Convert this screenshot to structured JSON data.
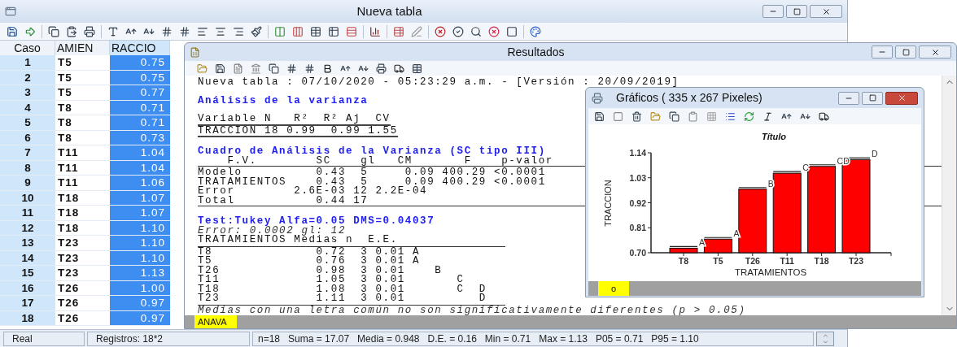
{
  "main_window": {
    "title": "Nueva tabla"
  },
  "grid": {
    "columns": [
      {
        "label": "Caso",
        "kind": "index",
        "selected": false
      },
      {
        "label": "AMIEN",
        "kind": "text",
        "selected": false
      },
      {
        "label": "RACCIO",
        "kind": "number",
        "selected": true
      }
    ],
    "rows": [
      [
        "1",
        "T5",
        "0.75"
      ],
      [
        "2",
        "T5",
        "0.75"
      ],
      [
        "3",
        "T5",
        "0.77"
      ],
      [
        "4",
        "T8",
        "0.71"
      ],
      [
        "5",
        "T8",
        "0.71"
      ],
      [
        "6",
        "T8",
        "0.73"
      ],
      [
        "7",
        "T11",
        "1.04"
      ],
      [
        "8",
        "T11",
        "1.04"
      ],
      [
        "9",
        "T11",
        "1.06"
      ],
      [
        "10",
        "T18",
        "1.07"
      ],
      [
        "11",
        "T18",
        "1.07"
      ],
      [
        "12",
        "T18",
        "1.10"
      ],
      [
        "13",
        "T23",
        "1.10"
      ],
      [
        "14",
        "T23",
        "1.10"
      ],
      [
        "15",
        "T23",
        "1.13"
      ],
      [
        "16",
        "T26",
        "1.00"
      ],
      [
        "17",
        "T26",
        "0.97"
      ],
      [
        "18",
        "T26",
        "0.97"
      ]
    ]
  },
  "status_bar": {
    "type": "Real",
    "records": "Registros: 18*2",
    "stats": "n=18   Suma = 17.07   Media = 0.948   D.E. = 0.16   Min = 0.71   Max = 1.13   P05 = 0.71   P95 = 1.10"
  },
  "results_window": {
    "title": "Resultados",
    "lines": [
      {
        "text": "Nueva tabla : 07/10/2020 - 05:23:29 a.m. - [Versión : 20/09/2019]",
        "kind": "plain"
      },
      {
        "text": "Análisis de la varianza",
        "kind": "heading",
        "space_before": true
      },
      {
        "text": "Variable N   R²  R² Aj  CV",
        "kind": "plain",
        "space_before": true,
        "rule_below": true
      },
      {
        "text": "TRACCION 18 0.99  0.99 1.55",
        "kind": "plain",
        "rule_below": true
      },
      {
        "text": "Cuadro de Análisis de la Varianza (SC tipo III)",
        "kind": "heading",
        "space_before": true
      },
      {
        "text": "    F.V.        SC    gl   CM       F    p-valor",
        "kind": "plain",
        "rule_below": true,
        "rule_full_width": true
      },
      {
        "text": "Modelo          0.43  5     0.09 400.29 <0.0001",
        "kind": "plain"
      },
      {
        "text": "TRATAMIENTOS    0.43  5     0.09 400.29 <0.0001",
        "kind": "plain"
      },
      {
        "text": "Error        2.6E-03 12 2.2E-04",
        "kind": "plain"
      },
      {
        "text": "Total           0.44 17",
        "kind": "plain",
        "rule_below": true,
        "rule_full_width": true
      },
      {
        "text": "Test:Tukey Alfa=0.05 DMS=0.04037",
        "kind": "heading",
        "space_before": true
      },
      {
        "text": "Error: 0.0002 gl: 12",
        "kind": "italic"
      },
      {
        "text": "TRATAMIENTOS Medias n  E.E.",
        "kind": "plain",
        "rule_below": true,
        "rule_table_width": true
      },
      {
        "text": "T8              0.72  3 0.01 A",
        "kind": "plain"
      },
      {
        "text": "T5              0.76  3 0.01 A",
        "kind": "plain"
      },
      {
        "text": "T26             0.98  3 0.01    B",
        "kind": "plain"
      },
      {
        "text": "T11             1.05  3 0.01       C",
        "kind": "plain"
      },
      {
        "text": "T18             1.08  3 0.01       C  D",
        "kind": "plain"
      },
      {
        "text": "T23             1.11  3 0.01          D",
        "kind": "plain",
        "rule_below": true,
        "rule_table_width": true
      },
      {
        "text": "Medias con una letra común no son significativamente diferentes (p > 0.05)",
        "kind": "italic"
      }
    ],
    "tabs": [
      {
        "label": "ANAVA",
        "selected": true
      }
    ]
  },
  "graph_window": {
    "title": "Gráficos ( 335 x 267 Pixeles)",
    "chart_data": {
      "type": "bar",
      "title": "Título",
      "xlabel": "TRATAMIENTOS",
      "ylabel": "TRACCION",
      "categories": [
        "T8",
        "T5",
        "T26",
        "T11",
        "T18",
        "T23"
      ],
      "series": [
        {
          "color": "#ff0000",
          "values": [
            0.72,
            0.76,
            0.98,
            1.05,
            1.08,
            1.11
          ]
        }
      ],
      "ylim": [
        0.7,
        1.14
      ],
      "yticks": [
        {
          "value": 0.7,
          "label": "0.70"
        },
        {
          "value": 0.81,
          "label": "0.81"
        },
        {
          "value": 0.92,
          "label": "0.92"
        },
        {
          "value": 1.03,
          "label": "1.03"
        },
        {
          "value": 1.14,
          "label": "1.14"
        }
      ],
      "value_labels": [
        "A",
        "A",
        "B",
        "C",
        "CD",
        "D"
      ]
    },
    "tabs": [
      {
        "label": "o",
        "selected": true
      }
    ]
  }
}
